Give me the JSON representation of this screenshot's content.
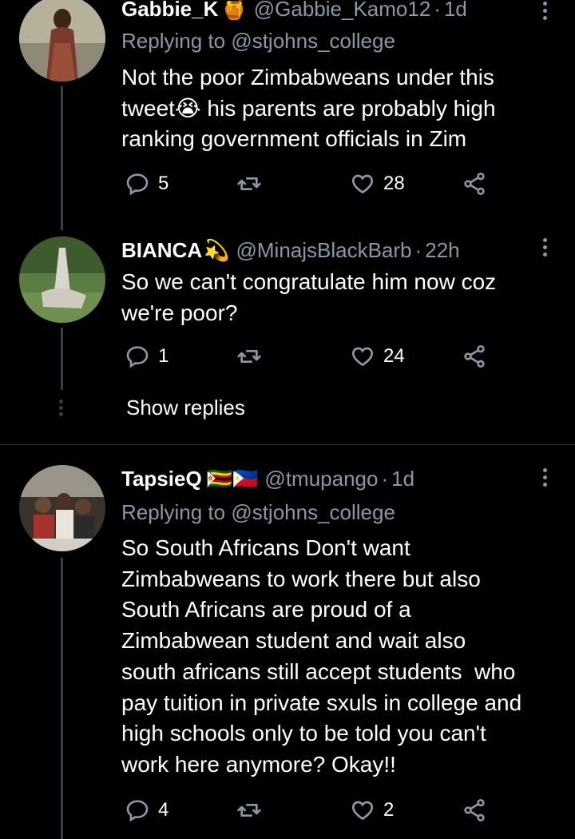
{
  "tweets": [
    {
      "name": "Gabbie_K",
      "name_emoji": "🍯",
      "handle": "@Gabbie_Kamo12",
      "time": "1d",
      "replying_label": "Replying to",
      "replying_handle": "@stjohns_college",
      "text_lines": [
        "Not the poor Zimbabweans under this",
        "tweet😭 his parents are probably high",
        "ranking government officials in Zim"
      ],
      "replies": "5",
      "retweets": "",
      "likes": "28"
    },
    {
      "name": "BIANCA",
      "name_emoji": "💫",
      "handle": "@MinajsBlackBarb",
      "time": "22h",
      "text_lines": [
        "So we can't congratulate him now coz",
        "we're poor?"
      ],
      "replies": "1",
      "retweets": "",
      "likes": "24"
    },
    {
      "name": "TapsieQ",
      "name_emoji": "🇿🇼🇵🇭",
      "handle": "@tmupango",
      "time": "1d",
      "replying_label": "Replying to",
      "replying_handle": "@stjohns_college",
      "text_lines": [
        "So South Africans Don't want",
        "Zimbabweans to work there but also",
        "South Africans are proud of a",
        "Zimbabwean student and wait also",
        "south africans still accept students  who",
        "pay tuition in private sxuls in college and",
        "high schools only to be told you can't",
        "work here anymore? Okay!!"
      ],
      "replies": "4",
      "retweets": "",
      "likes": "2"
    }
  ],
  "show_replies": "Show replies",
  "colors": {
    "background": "#000000",
    "secondary_text": "#8b98a5",
    "thread_line": "#3a3f44",
    "divider": "#2f3336"
  },
  "icons": {
    "reply": "reply-icon",
    "retweet": "retweet-icon",
    "like": "heart-icon",
    "share": "share-icon",
    "more": "more-vertical-icon"
  }
}
